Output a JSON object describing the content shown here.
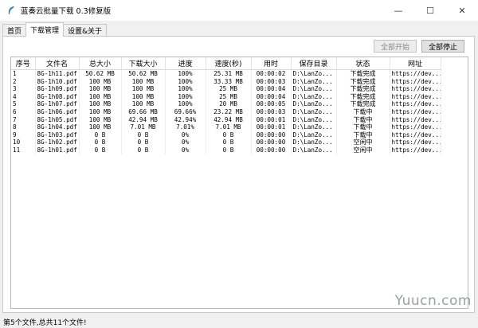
{
  "window": {
    "title": "蓝奏云批量下载 0.3修复版",
    "minimize_glyph": "—",
    "maximize_glyph": "☐",
    "close_glyph": "✕"
  },
  "tabs": [
    {
      "label": "首页",
      "active": false
    },
    {
      "label": "下载管理",
      "active": true
    },
    {
      "label": "设置&关于",
      "active": false
    }
  ],
  "toolbar": {
    "start_all_label": "全部开始",
    "stop_all_label": "全部停止"
  },
  "table": {
    "columns": [
      "序号",
      "文件名",
      "总大小",
      "下载大小",
      "进度",
      "速度(秒)",
      "用时",
      "保存目录",
      "状态",
      "网址"
    ],
    "rows": [
      [
        "1",
        "8G-1h11.pdf",
        "50.62 MB",
        "50.62 MB",
        "100%",
        "25.31 MB",
        "00:00:02",
        "D:\\LanZo...",
        "下载完成",
        "https://dev..."
      ],
      [
        "2",
        "8G-1h10.pdf",
        "100 MB",
        "100 MB",
        "100%",
        "33.33 MB",
        "00:00:03",
        "D:\\LanZo...",
        "下载完成",
        "https://dev..."
      ],
      [
        "3",
        "8G-1h09.pdf",
        "100 MB",
        "100 MB",
        "100%",
        "25 MB",
        "00:00:04",
        "D:\\LanZo...",
        "下载完成",
        "https://dev..."
      ],
      [
        "4",
        "8G-1h08.pdf",
        "100 MB",
        "100 MB",
        "100%",
        "25 MB",
        "00:00:04",
        "D:\\LanZo...",
        "下载完成",
        "https://dev..."
      ],
      [
        "5",
        "8G-1h07.pdf",
        "100 MB",
        "100 MB",
        "100%",
        "20 MB",
        "00:00:05",
        "D:\\LanZo...",
        "下载完成",
        "https://dev..."
      ],
      [
        "6",
        "8G-1h06.pdf",
        "100 MB",
        "69.66 MB",
        "69.66%",
        "23.22 MB",
        "00:00:03",
        "D:\\LanZo...",
        "下载中",
        "https://dev..."
      ],
      [
        "7",
        "8G-1h05.pdf",
        "100 MB",
        "42.94 MB",
        "42.94%",
        "42.94 MB",
        "00:00:01",
        "D:\\LanZo...",
        "下载中",
        "https://dev..."
      ],
      [
        "8",
        "8G-1h04.pdf",
        "100 MB",
        "7.01 MB",
        "7.01%",
        "7.01 MB",
        "00:00:01",
        "D:\\LanZo...",
        "下载中",
        "https://dev..."
      ],
      [
        "9",
        "8G-1h03.pdf",
        "0 B",
        "0 B",
        "0%",
        "0 B",
        "00:00:00",
        "D:\\LanZo...",
        "下载中",
        "https://dev..."
      ],
      [
        "10",
        "8G-1h02.pdf",
        "0 B",
        "0 B",
        "0%",
        "0 B",
        "00:00:00",
        "D:\\LanZo...",
        "空闲中",
        "https://dev..."
      ],
      [
        "11",
        "8G-1h01.pdf",
        "0 B",
        "0 B",
        "0%",
        "0 B",
        "00:00:00",
        "D:\\LanZo...",
        "空闲中",
        "https://dev..."
      ]
    ]
  },
  "status_bar": {
    "text": "第5个文件,总共11个文件!"
  },
  "watermark": {
    "text": "Yuucn.com"
  }
}
